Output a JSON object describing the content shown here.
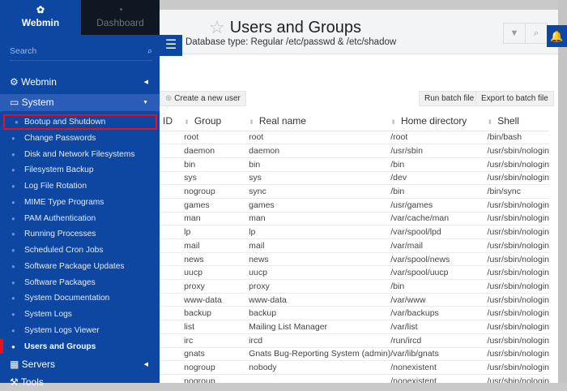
{
  "header": {
    "title": "Users and Groups",
    "db_type": "Database type: Regular /etc/passwd & /etc/shadow"
  },
  "toolbar": {
    "create_user": "Create a new user",
    "run_batch": "Run batch file",
    "export_batch": "Export to batch file"
  },
  "sidebar": {
    "tabs": [
      {
        "label": "Webmin",
        "icon": "webmin-logo-icon"
      },
      {
        "label": "Dashboard",
        "icon": "dashboard-gauge-icon"
      }
    ],
    "search_placeholder": "Search",
    "categories": {
      "webmin": "Webmin",
      "system": "System",
      "servers": "Servers",
      "tools": "Tools"
    },
    "items": [
      "Bootup and Shutdown",
      "Change Passwords",
      "Disk and Network Filesystems",
      "Filesystem Backup",
      "Log File Rotation",
      "MIME Type Programs",
      "PAM Authentication",
      "Running Processes",
      "Scheduled Cron Jobs",
      "Software Package Updates",
      "Software Packages",
      "System Documentation",
      "System Logs",
      "System Logs Viewer",
      "Users and Groups"
    ],
    "active_item": "Users and Groups",
    "highlighted_item": "Bootup and Shutdown"
  },
  "table": {
    "columns": [
      "ID",
      "Group",
      "Real name",
      "Home directory",
      "Shell"
    ],
    "rows": [
      [
        "",
        "root",
        "root",
        "/root",
        "/bin/bash"
      ],
      [
        "",
        "daemon",
        "daemon",
        "/usr/sbin",
        "/usr/sbin/nologin"
      ],
      [
        "",
        "bin",
        "bin",
        "/bin",
        "/usr/sbin/nologin"
      ],
      [
        "",
        "sys",
        "sys",
        "/dev",
        "/usr/sbin/nologin"
      ],
      [
        "",
        "nogroup",
        "sync",
        "/bin",
        "/bin/sync"
      ],
      [
        "",
        "games",
        "games",
        "/usr/games",
        "/usr/sbin/nologin"
      ],
      [
        "",
        "man",
        "man",
        "/var/cache/man",
        "/usr/sbin/nologin"
      ],
      [
        "",
        "lp",
        "lp",
        "/var/spool/lpd",
        "/usr/sbin/nologin"
      ],
      [
        "",
        "mail",
        "mail",
        "/var/mail",
        "/usr/sbin/nologin"
      ],
      [
        "",
        "news",
        "news",
        "/var/spool/news",
        "/usr/sbin/nologin"
      ],
      [
        "",
        "uucp",
        "uucp",
        "/var/spool/uucp",
        "/usr/sbin/nologin"
      ],
      [
        "",
        "proxy",
        "proxy",
        "/bin",
        "/usr/sbin/nologin"
      ],
      [
        "",
        "www-data",
        "www-data",
        "/var/www",
        "/usr/sbin/nologin"
      ],
      [
        "",
        "backup",
        "backup",
        "/var/backups",
        "/usr/sbin/nologin"
      ],
      [
        "",
        "list",
        "Mailing List Manager",
        "/var/list",
        "/usr/sbin/nologin"
      ],
      [
        "",
        "irc",
        "ircd",
        "/run/ircd",
        "/usr/sbin/nologin"
      ],
      [
        "",
        "gnats",
        "Gnats Bug-Reporting System (admin)",
        "/var/lib/gnats",
        "/usr/sbin/nologin"
      ],
      [
        "",
        "nogroup",
        "nobody",
        "/nonexistent",
        "/usr/sbin/nologin"
      ],
      [
        "",
        "nogroup",
        "",
        "/nonexistent",
        "/usr/sbin/nologin"
      ]
    ]
  },
  "colors": {
    "sidebar": "#0d47a1",
    "highlight": "#e8101f"
  }
}
